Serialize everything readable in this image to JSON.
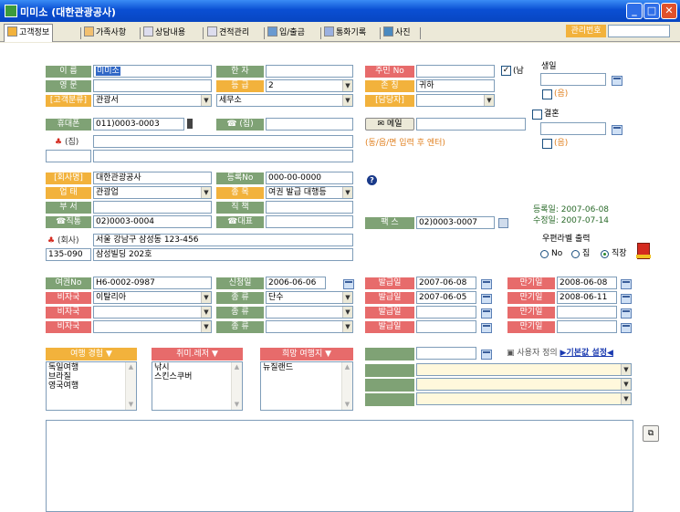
{
  "window": {
    "title": "미미소 (대한관광공사)"
  },
  "tabs": [
    {
      "label": "고객정보",
      "icon": "person-icon",
      "active": true
    },
    {
      "label": "가족사항",
      "icon": "family-icon"
    },
    {
      "label": "상담내용",
      "icon": "consult-icon"
    },
    {
      "label": "견적관리",
      "icon": "quote-icon"
    },
    {
      "label": "입/출금",
      "icon": "money-icon"
    },
    {
      "label": "통화기록",
      "icon": "phone-log-icon"
    },
    {
      "label": "사진",
      "icon": "photo-icon"
    }
  ],
  "manager": {
    "label": "관리번호",
    "value": ""
  },
  "personal": {
    "name_label": "이   름",
    "name": "미미소",
    "hanja_label": "한   자",
    "hanja": "",
    "english_label": "영   문",
    "english": "",
    "grade_label": "등   급",
    "grade": "2",
    "category_label": "[고객분류]",
    "category": "관광서",
    "category2": "세무소",
    "mobile_label": "휴대폰",
    "mobile": "011)0003-0003",
    "home_phone_label": "☎ (집)",
    "home_phone": "",
    "home_addr_label": "(집)",
    "home_addr": "",
    "home_zip": "",
    "resident_label": "주민 No",
    "resident": "",
    "gender_male": "남",
    "title_label": "존   칭",
    "title": "귀하",
    "assignee_label": "[담당자]",
    "assignee": "",
    "email_label": "메일",
    "email": "",
    "email_hint": "(동/읍/면 입력 후 엔터)",
    "birthday_label": "생일",
    "birthday": "",
    "lunar": "(음)",
    "anniversary_label": "결혼",
    "anniversary": "",
    "lunar2": "(음)"
  },
  "company": {
    "company_label": "[회사명]",
    "company": "대한관광공사",
    "reg_label": "등록No",
    "reg": "000-00-0000",
    "business_label": "업   태",
    "business": "관광업",
    "item_label": "종   목",
    "item": "여권 발급 대행등",
    "dept_label": "부   서",
    "dept": "",
    "position_label": "직   책",
    "position": "",
    "work_phone_label": "☎직통",
    "work_phone": "02)0003-0004",
    "main_phone_label": "☎대표",
    "main_phone": "",
    "fax_label": "팩   스",
    "fax": "02)0003-0007",
    "addr_label": "(회사)",
    "addr": "서울 강남구 삼성동 123-456",
    "zip": "135-090",
    "addr2": "삼성빌딩 202호",
    "registered": "등록일: 2007-06-08",
    "modified": "수정일: 2007-07-14",
    "mail_label_title": "우편라벨 출력",
    "mail_options": [
      "No",
      "집",
      "직장"
    ],
    "mail_selected": "직장"
  },
  "passport": {
    "passport_label": "여권No",
    "passport_no": "H6-0002-0987",
    "apply_label": "신청일",
    "apply_date": "2006-06-06",
    "visa_label": "비자국",
    "type_label": "종   류",
    "issue_label": "발급일",
    "expire_label": "만기일",
    "rows": [
      {
        "country": "",
        "type": "",
        "issue": "2007-06-08",
        "expire": "2008-06-08"
      },
      {
        "country": "이탈리아",
        "type": "단수",
        "issue": "2007-06-05",
        "expire": "2008-06-11"
      },
      {
        "country": "",
        "type": "",
        "issue": "",
        "expire": ""
      },
      {
        "country": "",
        "type": "",
        "issue": "",
        "expire": ""
      }
    ]
  },
  "travel": {
    "experience_label": "여행 경험 ▼",
    "experience": [
      "독일여행",
      "브라질",
      "영국여행"
    ],
    "hobby_label": "취미.레저 ▼",
    "hobby": [
      "낚시",
      "스킨스쿠버"
    ],
    "wish_label": "희망 여행지 ▼",
    "wish": [
      "뉴질랜드"
    ]
  },
  "custom": {
    "label": "사용자 정의",
    "link": "▶기본값 설정◀"
  },
  "colors": {
    "green": "#7fa275",
    "orange": "#f2b23c",
    "red": "#e76b6b",
    "title": "#0a4fd3"
  }
}
